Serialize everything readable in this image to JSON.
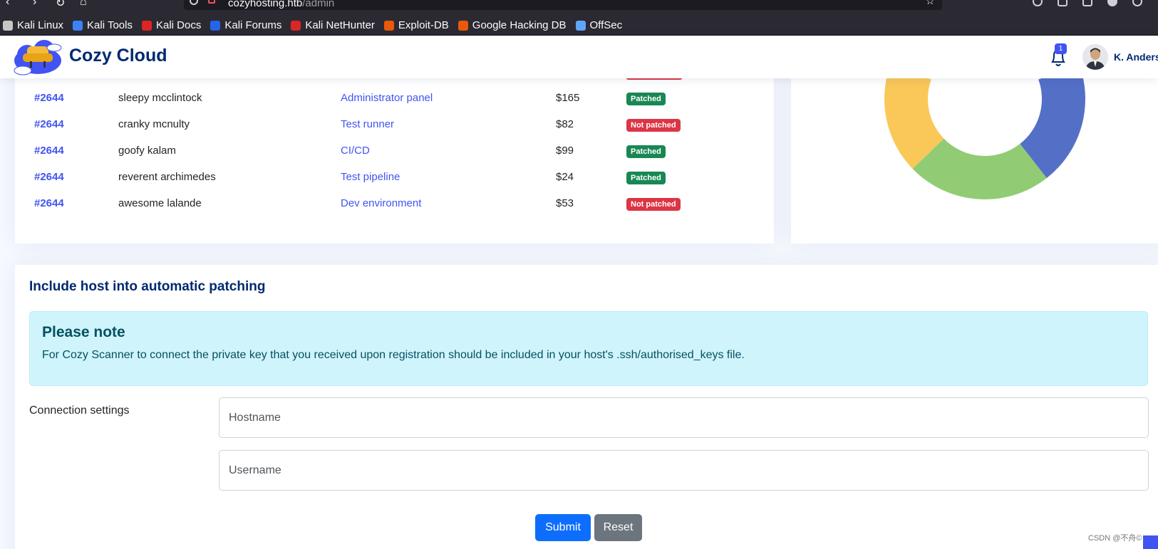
{
  "browser": {
    "url_host": "cozyhosting.htb",
    "url_path": "/admin",
    "bookmarks": [
      {
        "label": "Kali Linux",
        "color": "#c7c7c7"
      },
      {
        "label": "Kali Tools",
        "color": "#3b82f6"
      },
      {
        "label": "Kali Docs",
        "color": "#dc2626"
      },
      {
        "label": "Kali Forums",
        "color": "#2563eb"
      },
      {
        "label": "Kali NetHunter",
        "color": "#dc2626"
      },
      {
        "label": "Exploit-DB",
        "color": "#ea580c"
      },
      {
        "label": "Google Hacking DB",
        "color": "#ea580c"
      },
      {
        "label": "OffSec",
        "color": "#60a5fa"
      }
    ]
  },
  "header": {
    "brand": "Cozy Cloud",
    "notification_count": "1",
    "user_name": "K. Anderson"
  },
  "table": {
    "rows": [
      {
        "id": "#2644",
        "name": "sleepy mcclintock",
        "product": "Administrator panel",
        "price": "$165",
        "status": "Patched"
      },
      {
        "id": "#2644",
        "name": "cranky mcnulty",
        "product": "Test runner",
        "price": "$82",
        "status": "Not patched"
      },
      {
        "id": "#2644",
        "name": "goofy kalam",
        "product": "CI/CD",
        "price": "$99",
        "status": "Patched"
      },
      {
        "id": "#2644",
        "name": "reverent archimedes",
        "product": "Test pipeline",
        "price": "$24",
        "status": "Patched"
      },
      {
        "id": "#2644",
        "name": "awesome lalande",
        "product": "Dev environment",
        "price": "$53",
        "status": "Not patched"
      }
    ]
  },
  "donut": {
    "colors": {
      "blue": "#5470c6",
      "green": "#91cc75",
      "yellow": "#fac858"
    }
  },
  "form": {
    "title": "Include host into automatic patching",
    "alert_heading": "Please note",
    "alert_text": "For Cozy Scanner to connect the private key that you received upon registration should be included in your host's .ssh/authorised_keys file.",
    "connection_label": "Connection settings",
    "hostname_placeholder": "Hostname",
    "username_placeholder": "Username",
    "submit_label": "Submit",
    "reset_label": "Reset"
  },
  "watermark": "CSDN @不舟©"
}
